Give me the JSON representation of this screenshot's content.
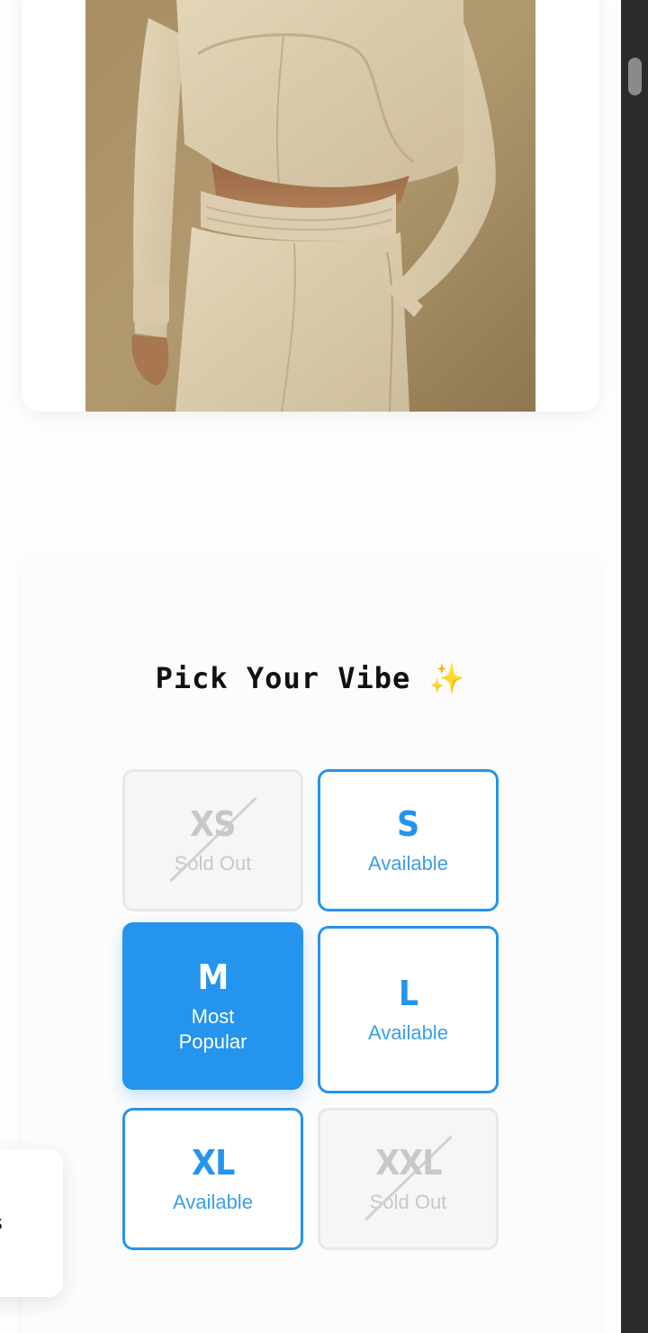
{
  "product": {
    "image_alt": "Woman wearing beige cropped sweatshirt and sweatpants"
  },
  "size_picker": {
    "title": "Pick Your Vibe",
    "title_icon": "sparkles-icon",
    "title_icon_glyph": "✨",
    "selected": "M",
    "sizes": [
      {
        "code": "XS",
        "status": "Sold Out",
        "state": "sold-out"
      },
      {
        "code": "S",
        "status": "Available",
        "state": "available"
      },
      {
        "code": "M",
        "status": "Most Popular",
        "state": "selected"
      },
      {
        "code": "L",
        "status": "Available",
        "state": "available"
      },
      {
        "code": "XL",
        "status": "Available",
        "state": "available"
      },
      {
        "code": "XXL",
        "status": "Sold Out",
        "state": "sold-out"
      }
    ]
  },
  "toast": {
    "text": "s!"
  },
  "colors": {
    "accent": "#2494ee",
    "sold_out": "#c8c8c8",
    "scrollbar_track": "#2b2b2b",
    "scrollbar_thumb": "#8a8a8a"
  }
}
